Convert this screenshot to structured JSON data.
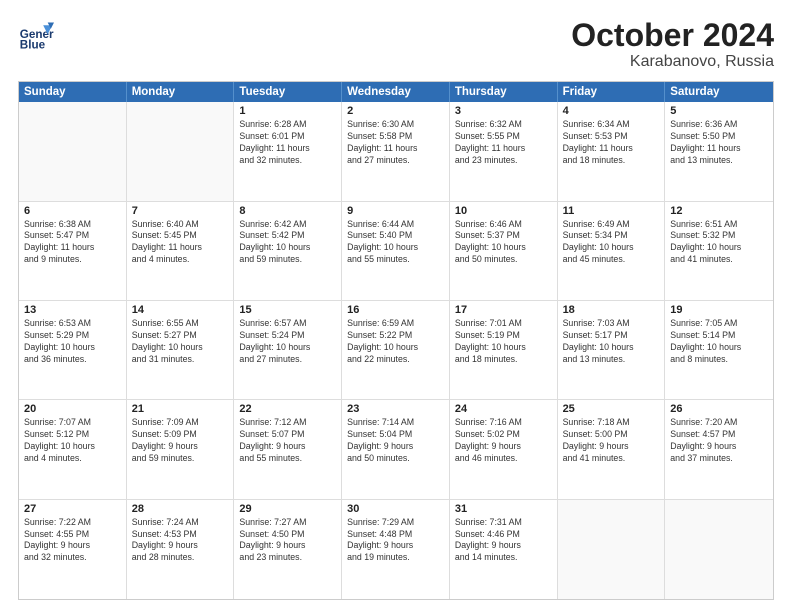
{
  "header": {
    "logo_line1": "General",
    "logo_line2": "Blue",
    "month": "October 2024",
    "location": "Karabanovo, Russia"
  },
  "weekdays": [
    "Sunday",
    "Monday",
    "Tuesday",
    "Wednesday",
    "Thursday",
    "Friday",
    "Saturday"
  ],
  "weeks": [
    [
      {
        "day": "",
        "info": ""
      },
      {
        "day": "",
        "info": ""
      },
      {
        "day": "1",
        "info": "Sunrise: 6:28 AM\nSunset: 6:01 PM\nDaylight: 11 hours\nand 32 minutes."
      },
      {
        "day": "2",
        "info": "Sunrise: 6:30 AM\nSunset: 5:58 PM\nDaylight: 11 hours\nand 27 minutes."
      },
      {
        "day": "3",
        "info": "Sunrise: 6:32 AM\nSunset: 5:55 PM\nDaylight: 11 hours\nand 23 minutes."
      },
      {
        "day": "4",
        "info": "Sunrise: 6:34 AM\nSunset: 5:53 PM\nDaylight: 11 hours\nand 18 minutes."
      },
      {
        "day": "5",
        "info": "Sunrise: 6:36 AM\nSunset: 5:50 PM\nDaylight: 11 hours\nand 13 minutes."
      }
    ],
    [
      {
        "day": "6",
        "info": "Sunrise: 6:38 AM\nSunset: 5:47 PM\nDaylight: 11 hours\nand 9 minutes."
      },
      {
        "day": "7",
        "info": "Sunrise: 6:40 AM\nSunset: 5:45 PM\nDaylight: 11 hours\nand 4 minutes."
      },
      {
        "day": "8",
        "info": "Sunrise: 6:42 AM\nSunset: 5:42 PM\nDaylight: 10 hours\nand 59 minutes."
      },
      {
        "day": "9",
        "info": "Sunrise: 6:44 AM\nSunset: 5:40 PM\nDaylight: 10 hours\nand 55 minutes."
      },
      {
        "day": "10",
        "info": "Sunrise: 6:46 AM\nSunset: 5:37 PM\nDaylight: 10 hours\nand 50 minutes."
      },
      {
        "day": "11",
        "info": "Sunrise: 6:49 AM\nSunset: 5:34 PM\nDaylight: 10 hours\nand 45 minutes."
      },
      {
        "day": "12",
        "info": "Sunrise: 6:51 AM\nSunset: 5:32 PM\nDaylight: 10 hours\nand 41 minutes."
      }
    ],
    [
      {
        "day": "13",
        "info": "Sunrise: 6:53 AM\nSunset: 5:29 PM\nDaylight: 10 hours\nand 36 minutes."
      },
      {
        "day": "14",
        "info": "Sunrise: 6:55 AM\nSunset: 5:27 PM\nDaylight: 10 hours\nand 31 minutes."
      },
      {
        "day": "15",
        "info": "Sunrise: 6:57 AM\nSunset: 5:24 PM\nDaylight: 10 hours\nand 27 minutes."
      },
      {
        "day": "16",
        "info": "Sunrise: 6:59 AM\nSunset: 5:22 PM\nDaylight: 10 hours\nand 22 minutes."
      },
      {
        "day": "17",
        "info": "Sunrise: 7:01 AM\nSunset: 5:19 PM\nDaylight: 10 hours\nand 18 minutes."
      },
      {
        "day": "18",
        "info": "Sunrise: 7:03 AM\nSunset: 5:17 PM\nDaylight: 10 hours\nand 13 minutes."
      },
      {
        "day": "19",
        "info": "Sunrise: 7:05 AM\nSunset: 5:14 PM\nDaylight: 10 hours\nand 8 minutes."
      }
    ],
    [
      {
        "day": "20",
        "info": "Sunrise: 7:07 AM\nSunset: 5:12 PM\nDaylight: 10 hours\nand 4 minutes."
      },
      {
        "day": "21",
        "info": "Sunrise: 7:09 AM\nSunset: 5:09 PM\nDaylight: 9 hours\nand 59 minutes."
      },
      {
        "day": "22",
        "info": "Sunrise: 7:12 AM\nSunset: 5:07 PM\nDaylight: 9 hours\nand 55 minutes."
      },
      {
        "day": "23",
        "info": "Sunrise: 7:14 AM\nSunset: 5:04 PM\nDaylight: 9 hours\nand 50 minutes."
      },
      {
        "day": "24",
        "info": "Sunrise: 7:16 AM\nSunset: 5:02 PM\nDaylight: 9 hours\nand 46 minutes."
      },
      {
        "day": "25",
        "info": "Sunrise: 7:18 AM\nSunset: 5:00 PM\nDaylight: 9 hours\nand 41 minutes."
      },
      {
        "day": "26",
        "info": "Sunrise: 7:20 AM\nSunset: 4:57 PM\nDaylight: 9 hours\nand 37 minutes."
      }
    ],
    [
      {
        "day": "27",
        "info": "Sunrise: 7:22 AM\nSunset: 4:55 PM\nDaylight: 9 hours\nand 32 minutes."
      },
      {
        "day": "28",
        "info": "Sunrise: 7:24 AM\nSunset: 4:53 PM\nDaylight: 9 hours\nand 28 minutes."
      },
      {
        "day": "29",
        "info": "Sunrise: 7:27 AM\nSunset: 4:50 PM\nDaylight: 9 hours\nand 23 minutes."
      },
      {
        "day": "30",
        "info": "Sunrise: 7:29 AM\nSunset: 4:48 PM\nDaylight: 9 hours\nand 19 minutes."
      },
      {
        "day": "31",
        "info": "Sunrise: 7:31 AM\nSunset: 4:46 PM\nDaylight: 9 hours\nand 14 minutes."
      },
      {
        "day": "",
        "info": ""
      },
      {
        "day": "",
        "info": ""
      }
    ]
  ]
}
